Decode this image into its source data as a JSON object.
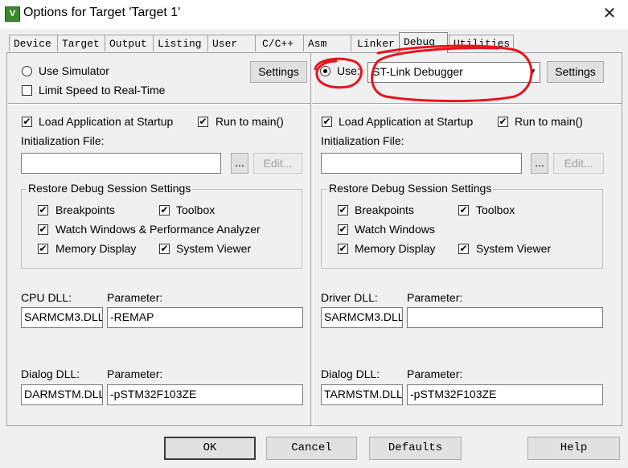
{
  "window": {
    "title": "Options for Target 'Target 1'",
    "app_icon_letter": "V",
    "close_glyph": "✕"
  },
  "tabs": [
    {
      "label": "Device",
      "active": false
    },
    {
      "label": "Target",
      "active": false
    },
    {
      "label": "Output",
      "active": false
    },
    {
      "label": "Listing",
      "active": false
    },
    {
      "label": "User",
      "active": false
    },
    {
      "label": "C/C++",
      "active": false
    },
    {
      "label": "Asm",
      "active": false
    },
    {
      "label": "Linker",
      "active": false
    },
    {
      "label": "Debug",
      "active": true
    },
    {
      "label": "Utilities",
      "active": false
    }
  ],
  "left": {
    "use_simulator": {
      "label": "Use Simulator",
      "checked": false
    },
    "limit_speed": {
      "label": "Limit Speed to Real-Time",
      "checked": false
    },
    "settings_label": "Settings",
    "load_app": {
      "label": "Load Application at Startup",
      "checked": true
    },
    "run_to_main": {
      "label": "Run to main()",
      "checked": true
    },
    "init_file_label": "Initialization File:",
    "init_file_value": "",
    "browse_label": "...",
    "edit_label": "Edit...",
    "restore_group_label": "Restore Debug Session Settings",
    "breakpoints": {
      "label": "Breakpoints",
      "checked": true
    },
    "toolbox": {
      "label": "Toolbox",
      "checked": true
    },
    "watch_windows": {
      "label": "Watch Windows & Performance Analyzer",
      "checked": true
    },
    "memory_display": {
      "label": "Memory Display",
      "checked": true
    },
    "system_viewer": {
      "label": "System Viewer",
      "checked": true
    },
    "cpu_dll_label": "CPU DLL:",
    "cpu_dll_value": "SARMCM3.DLL",
    "cpu_param_label": "Parameter:",
    "cpu_param_value": "-REMAP",
    "dialog_dll_label": "Dialog DLL:",
    "dialog_dll_value": "DARMSTM.DLL",
    "dialog_param_label": "Parameter:",
    "dialog_param_value": "-pSTM32F103ZE"
  },
  "right": {
    "use": {
      "label": "Use:",
      "checked": true
    },
    "debugger_select": "ST-Link Debugger",
    "settings_label": "Settings",
    "load_app": {
      "label": "Load Application at Startup",
      "checked": true
    },
    "run_to_main": {
      "label": "Run to main()",
      "checked": true
    },
    "init_file_label": "Initialization File:",
    "init_file_value": "",
    "browse_label": "...",
    "edit_label": "Edit...",
    "restore_group_label": "Restore Debug Session Settings",
    "breakpoints": {
      "label": "Breakpoints",
      "checked": true
    },
    "toolbox": {
      "label": "Toolbox",
      "checked": true
    },
    "watch_windows": {
      "label": "Watch Windows",
      "checked": true
    },
    "memory_display": {
      "label": "Memory Display",
      "checked": true
    },
    "system_viewer": {
      "label": "System Viewer",
      "checked": true
    },
    "driver_dll_label": "Driver DLL:",
    "driver_dll_value": "SARMCM3.DLL",
    "driver_param_label": "Parameter:",
    "driver_param_value": "",
    "dialog_dll_label": "Dialog DLL:",
    "dialog_dll_value": "TARMSTM.DLL",
    "dialog_param_label": "Parameter:",
    "dialog_param_value": "-pSTM32F103ZE"
  },
  "footer": {
    "ok": "OK",
    "cancel": "Cancel",
    "defaults": "Defaults",
    "help": "Help"
  },
  "colors": {
    "dialog_bg": "#f0f0f0",
    "annotation": "#e8141c"
  },
  "check_glyph": "✔"
}
